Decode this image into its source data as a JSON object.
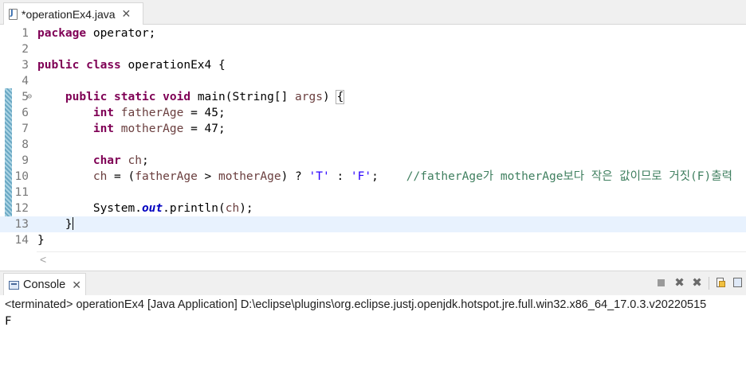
{
  "editor_tab": {
    "title": "*operationEx4.java",
    "close": "✕"
  },
  "code_lines": [
    {
      "n": "1",
      "t": "package operator;"
    },
    {
      "n": "2",
      "t": ""
    },
    {
      "n": "3",
      "t": "public class operationEx4 {"
    },
    {
      "n": "4",
      "t": ""
    },
    {
      "n": "5",
      "t": "    public static void main(String[] args) {"
    },
    {
      "n": "6",
      "t": "        int fatherAge = 45;"
    },
    {
      "n": "7",
      "t": "        int motherAge = 47;"
    },
    {
      "n": "8",
      "t": ""
    },
    {
      "n": "9",
      "t": "        char ch;"
    },
    {
      "n": "10",
      "t": "        ch = (fatherAge > motherAge) ? 'T' : 'F';    //fatherAge가 motherAge보다 작은 값이므로 거짓(F)출력"
    },
    {
      "n": "11",
      "t": ""
    },
    {
      "n": "12",
      "t": "        System.out.println(ch);"
    },
    {
      "n": "13",
      "t": "    }"
    },
    {
      "n": "14",
      "t": "}"
    }
  ],
  "hscroll": {
    "left_arrow": "<"
  },
  "console_tab": {
    "title": "Console",
    "close": "✕"
  },
  "console_toolbar": {
    "remove_icon": "✖",
    "remove_all_icon": "✖"
  },
  "console": {
    "status": "<terminated> operationEx4 [Java Application] D:\\eclipse\\plugins\\org.eclipse.justj.openjdk.hotspot.jre.full.win32.x86_64_17.0.3.v20220515",
    "output": "F"
  },
  "colors": {
    "keyword": "#7f0055",
    "variable": "#6a3e3e",
    "string": "#2a00ff",
    "comment": "#3f7f5f",
    "field": "#0000c0",
    "current_line": "#e8f2fe"
  }
}
